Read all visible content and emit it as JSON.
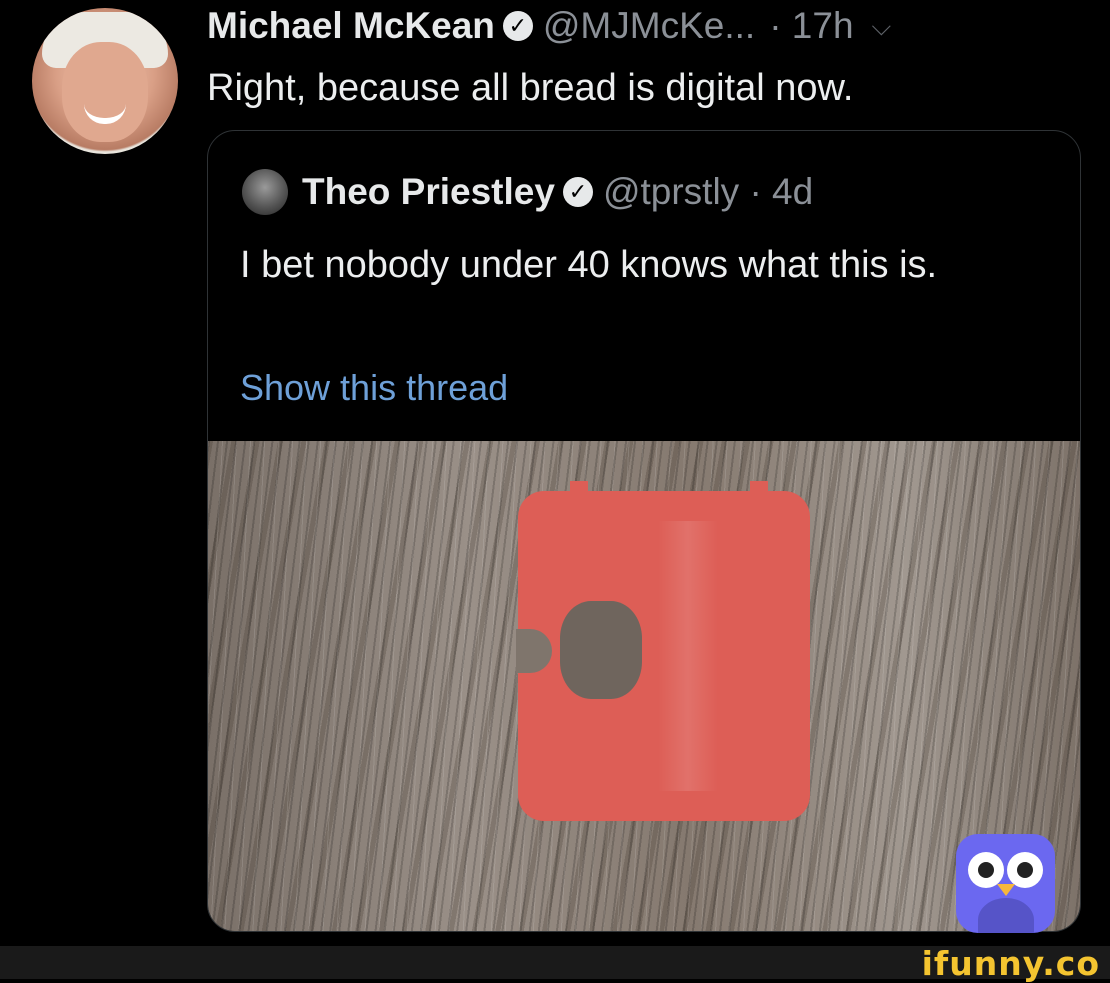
{
  "tweet": {
    "author_name": "Michael McKean",
    "handle": "@MJMcKe...",
    "time": "· 17h",
    "text": "Right, because all bread is digital now."
  },
  "quoted_tweet": {
    "author_name": "Theo Priestley",
    "handle_time": "@tprstly · 4d",
    "text": "I bet nobody under 40 knows what this is.",
    "show_thread_label": "Show this thread"
  },
  "watermark": {
    "text": "ifunny.co"
  },
  "icons": {
    "verified": "verified-badge-icon",
    "caret": "chevron-down-icon",
    "app": "ifunny-owl-logo"
  },
  "colors": {
    "background": "#000000",
    "link": "#6ea0d8",
    "muted": "#8b9097",
    "bread_clip": "#dd5e56",
    "watermark": "#f4c430"
  }
}
